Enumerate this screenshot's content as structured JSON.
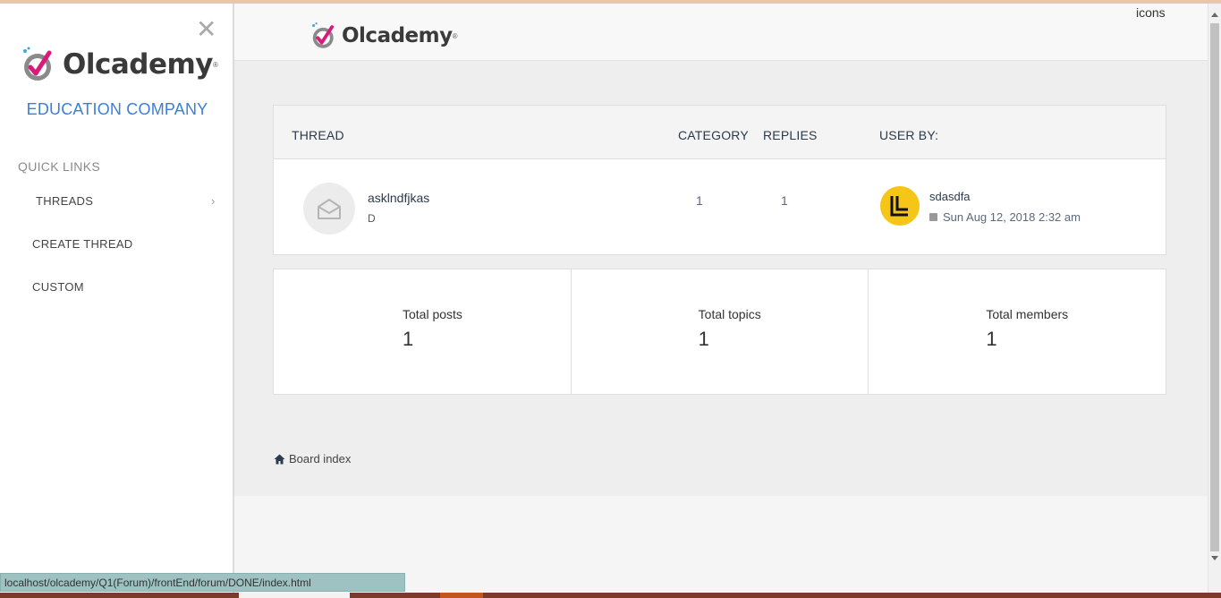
{
  "sidebar": {
    "close_label": "✕",
    "logo_text": "Olcademy",
    "company": "EDUCATION COMPANY",
    "quick_links_label": "QUICK LINKS",
    "items": [
      {
        "label": "THREADS",
        "icon": "chevron-right-icon"
      },
      {
        "label": "CREATE THREAD"
      },
      {
        "label": "CUSTOM"
      }
    ]
  },
  "header": {
    "logo_text": "Olcademy",
    "icons_text": "icons"
  },
  "table": {
    "headers": [
      "THREAD",
      "CATEGORY",
      "REPLIES",
      "USER BY:"
    ],
    "rows": [
      {
        "thread_title": "asklndfjkas",
        "thread_desc": "D",
        "category": "1",
        "replies": "1",
        "user": "sdasdfa",
        "time": "Sun Aug 12, 2018 2:32 am"
      }
    ]
  },
  "stats": [
    {
      "label": "Total posts",
      "value": "1"
    },
    {
      "label": "Total topics",
      "value": "1"
    },
    {
      "label": "Total members",
      "value": "1"
    }
  ],
  "footer": {
    "board_index": "Board index",
    "status_url": "localhost/olcademy/Q1(Forum)/frontEnd/forum/DONE/index.html"
  },
  "colors": {
    "accent": "#3b7fdb",
    "avatar_bg": "#f5c518",
    "logo_pink": "#d81b7a",
    "logo_blue": "#3da9e0"
  }
}
